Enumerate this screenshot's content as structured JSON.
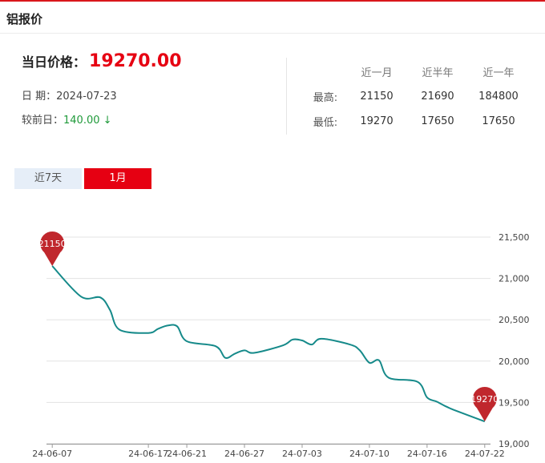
{
  "header": {
    "title": "铝报价"
  },
  "summary": {
    "price_label": "当日价格：",
    "price_value": "19270.00",
    "date_label": "日 期：",
    "date_value": "2024-07-23",
    "change_label": "较前日：",
    "change_value": "140.00 ↓"
  },
  "stats": {
    "columns": [
      "近一月",
      "近半年",
      "近一年"
    ],
    "rows": [
      {
        "label": "最高:",
        "values": [
          "21150",
          "21690",
          "184800"
        ]
      },
      {
        "label": "最低:",
        "values": [
          "19270",
          "17650",
          "17650"
        ]
      }
    ]
  },
  "tabs": [
    {
      "label": "近7天",
      "active": false
    },
    {
      "label": "1月",
      "active": true
    }
  ],
  "colors": {
    "accent": "#e60012",
    "line": "#168a8a",
    "marker": "#c0272d",
    "down": "#1f9a3a"
  },
  "chart_data": {
    "type": "line",
    "x_tick_labels": [
      "24-06-07",
      "24-06-17",
      "24-06-21",
      "24-06-27",
      "24-07-03",
      "24-07-10",
      "24-07-16",
      "24-07-22"
    ],
    "y_tick_labels": [
      "21,500",
      "21,000",
      "20,500",
      "20,000",
      "19,500",
      "19,000"
    ],
    "ylim": [
      19000,
      21500
    ],
    "grid": true,
    "series": [
      {
        "points": [
          [
            "24-06-07",
            21150
          ],
          [
            "24-06-10",
            20780
          ],
          [
            "24-06-12",
            20770
          ],
          [
            "24-06-13",
            20620
          ],
          [
            "24-06-14",
            20380
          ],
          [
            "24-06-17",
            20340
          ],
          [
            "24-06-18",
            20390
          ],
          [
            "24-06-19",
            20430
          ],
          [
            "24-06-20",
            20420
          ],
          [
            "24-06-21",
            20240
          ],
          [
            "24-06-24",
            20180
          ],
          [
            "24-06-25",
            20040
          ],
          [
            "24-06-26",
            20090
          ],
          [
            "24-06-27",
            20130
          ],
          [
            "24-06-28",
            20100
          ],
          [
            "24-07-01",
            20190
          ],
          [
            "24-07-02",
            20260
          ],
          [
            "24-07-03",
            20250
          ],
          [
            "24-07-04",
            20200
          ],
          [
            "24-07-05",
            20270
          ],
          [
            "24-07-08",
            20200
          ],
          [
            "24-07-09",
            20130
          ],
          [
            "24-07-10",
            19980
          ],
          [
            "24-07-11",
            20010
          ],
          [
            "24-07-12",
            19800
          ],
          [
            "24-07-15",
            19750
          ],
          [
            "24-07-16",
            19560
          ],
          [
            "24-07-17",
            19510
          ],
          [
            "24-07-18",
            19450
          ],
          [
            "24-07-19",
            19400
          ],
          [
            "24-07-22",
            19270
          ]
        ]
      }
    ],
    "markers": [
      {
        "label": "21150",
        "point": "first"
      },
      {
        "label": "19270",
        "point": "last"
      }
    ]
  }
}
